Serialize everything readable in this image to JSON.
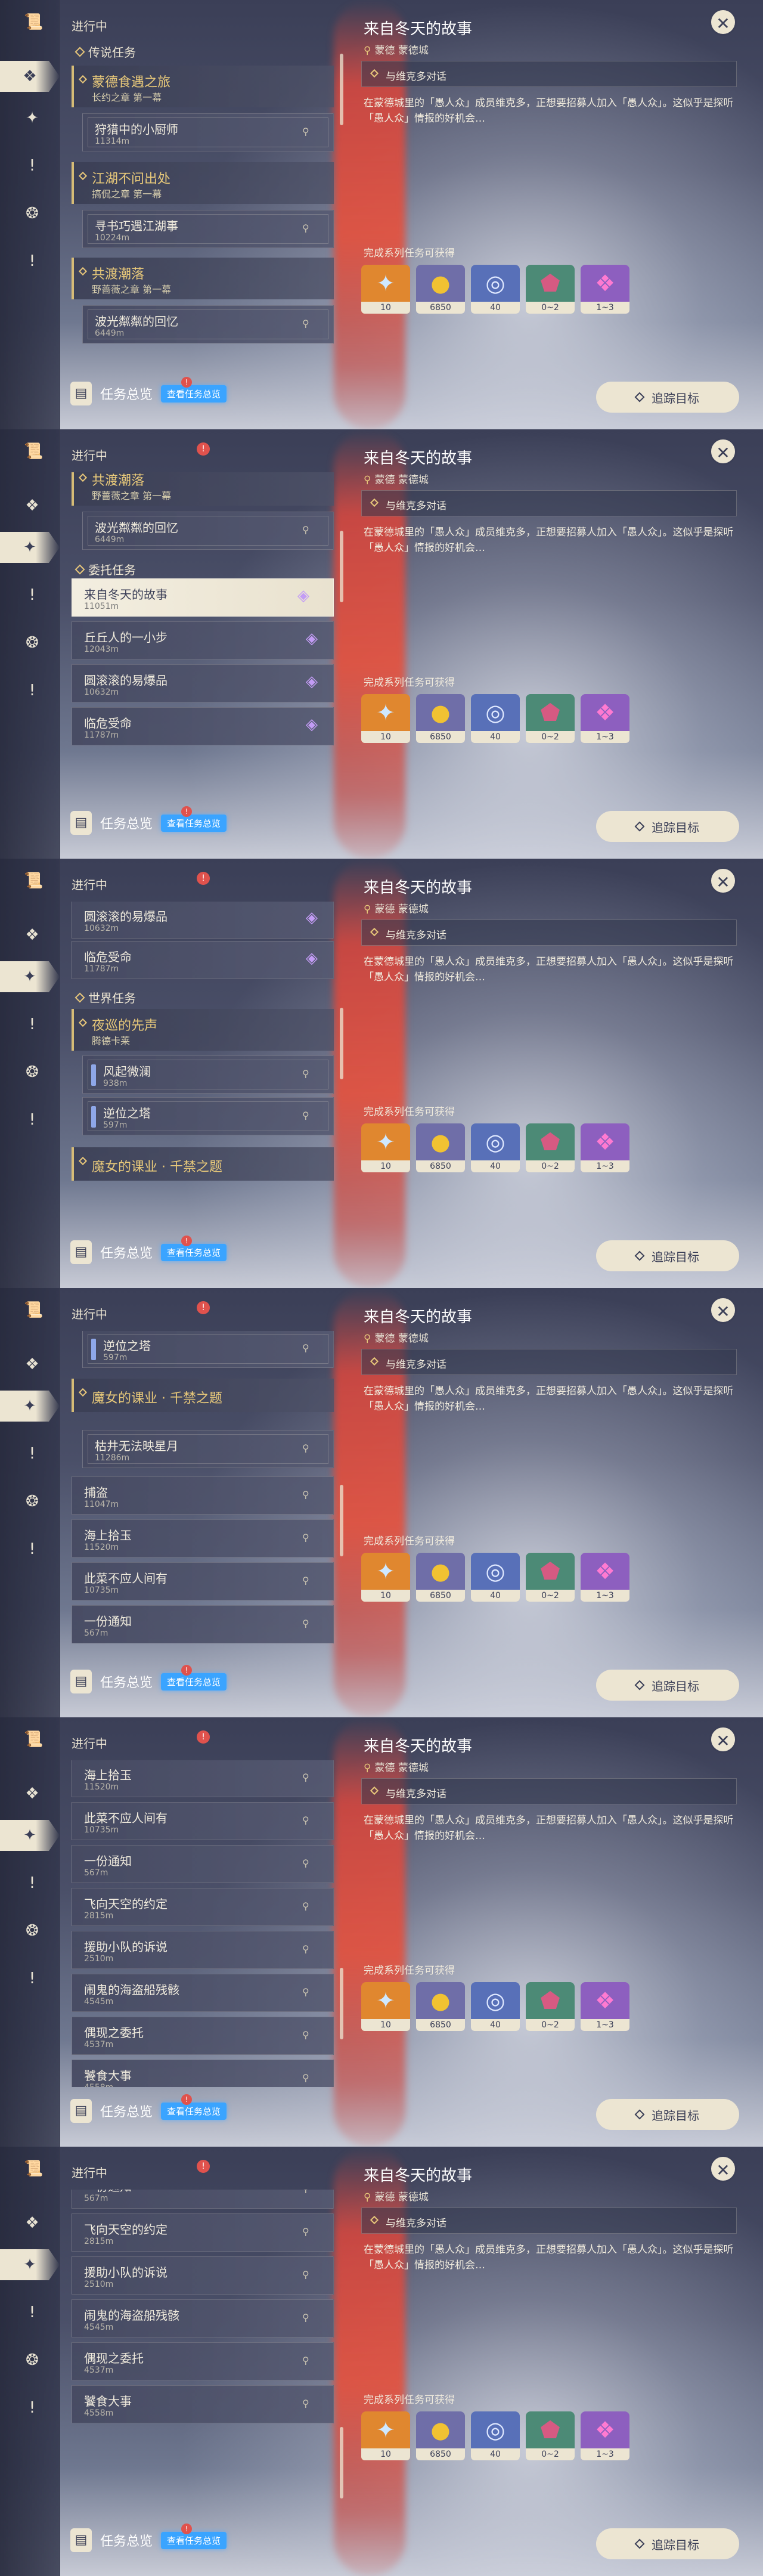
{
  "header": {
    "in_progress": "进行中"
  },
  "rail_icons": [
    "quest-scroll-icon",
    "commission-icon",
    "archon-icon",
    "alert-icon",
    "world-icon",
    "alert-icon"
  ],
  "sections": {
    "legend": "传说任务",
    "commission": "委托任务",
    "world": "世界任务"
  },
  "groups": {
    "mondstadt_food": {
      "title": "蒙德食遇之旅",
      "sub": "长约之章 第一幕"
    },
    "jianghu": {
      "title": "江湖不问出处",
      "sub": "搞侃之章 第一幕"
    },
    "gongdu": {
      "title": "共渡潮落",
      "sub": "野蔷薇之章 第一幕"
    },
    "night_pioneer": {
      "title": "夜巡的先声",
      "sub": "腾德卡莱"
    },
    "witch": {
      "title": "魔女的课业 · 千禁之题"
    }
  },
  "items": {
    "little_cook": {
      "title": "狩猎中的小厨师",
      "dist": "11314m"
    },
    "find_jianghu": {
      "title": "寻书巧遇江湖事",
      "dist": "10224m"
    },
    "bo_guang": {
      "title": "波光粼粼的回忆",
      "dist": "6449m"
    },
    "winter_story": {
      "title": "来自冬天的故事",
      "dist": "11051m"
    },
    "qiuqiu_step": {
      "title": "丘丘人的一小步",
      "dist": "12043m"
    },
    "round_bomb": {
      "title": "圆滚滚的易爆品",
      "dist": "10632m"
    },
    "lin_wei": {
      "title": "临危受命",
      "dist": "11787m"
    },
    "feng_qi": {
      "title": "风起微澜",
      "dist": "938m"
    },
    "nizhi_tower": {
      "title": "逆位之塔",
      "dist": "597m"
    },
    "kuzhi": {
      "title": "枯井无法映星月",
      "dist": "11286m"
    },
    "buzhuo": {
      "title": "捕盗",
      "dist": "11047m"
    },
    "haishang": {
      "title": "海上拾玉",
      "dist": "11520m"
    },
    "cicai": {
      "title": "此菜不应人间有",
      "dist": "10735m"
    },
    "yifen": {
      "title": "一份通知",
      "dist": "567m"
    },
    "feixiang": {
      "title": "飞向天空的约定",
      "dist": "2815m"
    },
    "yuanzhu": {
      "title": "援助小队的诉说",
      "dist": "2510m"
    },
    "naogui": {
      "title": "闹鬼的海盗船残骸",
      "dist": "4545m"
    },
    "ouxian": {
      "title": "偶现之委托",
      "dist": "4537m"
    },
    "xiaoshi": {
      "title": "饕食大事",
      "dist": "4558m"
    }
  },
  "bottom": {
    "overview_label": "任务总览",
    "overview_badge": "查看任务总览",
    "track_label": "追踪目标"
  },
  "detail": {
    "title": "来自冬天的故事",
    "location": "蒙德 蒙德城",
    "objective": "与维克多对话",
    "description": "在蒙德城里的「愚人众」成员维克多，正想要招募人加入「愚人众」。这似乎是探听「愚人众」情报的好机会…",
    "reward_label": "完成系列任务可获得",
    "rewards": [
      {
        "name": "adventure-exp-icon",
        "value": "10",
        "color": "#e0872f"
      },
      {
        "name": "mora-icon",
        "value": "6850",
        "color": "#6f6ea8"
      },
      {
        "name": "hero-wit-icon",
        "value": "40",
        "color": "#5870b8"
      },
      {
        "name": "mystic-ore-icon",
        "value": "0~2",
        "color": "#4c8a76"
      },
      {
        "name": "crystal-icon",
        "value": "1~3",
        "color": "#8d5fbf"
      }
    ]
  }
}
